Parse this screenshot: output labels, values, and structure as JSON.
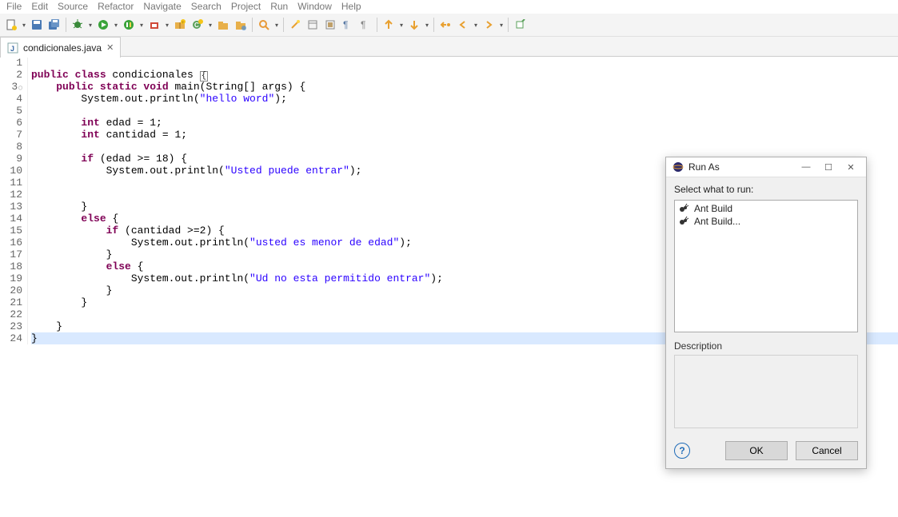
{
  "menu": [
    "File",
    "Edit",
    "Source",
    "Refactor",
    "Navigate",
    "Search",
    "Project",
    "Run",
    "Window",
    "Help"
  ],
  "tab": {
    "label": "condicionales.java"
  },
  "code": {
    "lines": [
      {
        "n": 1,
        "tokens": []
      },
      {
        "n": 2,
        "tokens": [
          {
            "c": "kw",
            "t": "public class"
          },
          {
            "c": "plain",
            "t": " condicionales "
          },
          {
            "c": "boxch",
            "t": "{"
          }
        ]
      },
      {
        "n": 3,
        "circ": true,
        "tokens": [
          {
            "c": "plain",
            "t": "    "
          },
          {
            "c": "kw",
            "t": "public static void"
          },
          {
            "c": "plain",
            "t": " main(String[] args) {"
          }
        ]
      },
      {
        "n": 4,
        "tokens": [
          {
            "c": "plain",
            "t": "        System.out.println("
          },
          {
            "c": "str",
            "t": "\"hello word\""
          },
          {
            "c": "plain",
            "t": ");"
          }
        ]
      },
      {
        "n": 5,
        "tokens": []
      },
      {
        "n": 6,
        "tokens": [
          {
            "c": "plain",
            "t": "        "
          },
          {
            "c": "kw",
            "t": "int"
          },
          {
            "c": "plain",
            "t": " edad = 1;"
          }
        ]
      },
      {
        "n": 7,
        "tokens": [
          {
            "c": "plain",
            "t": "        "
          },
          {
            "c": "kw",
            "t": "int"
          },
          {
            "c": "plain",
            "t": " cantidad = 1;"
          }
        ]
      },
      {
        "n": 8,
        "tokens": []
      },
      {
        "n": 9,
        "tokens": [
          {
            "c": "plain",
            "t": "        "
          },
          {
            "c": "kw",
            "t": "if"
          },
          {
            "c": "plain",
            "t": " (edad >= 18) {"
          }
        ]
      },
      {
        "n": 10,
        "tokens": [
          {
            "c": "plain",
            "t": "            System.out.println("
          },
          {
            "c": "str",
            "t": "\"Usted puede entrar\""
          },
          {
            "c": "plain",
            "t": ");"
          }
        ]
      },
      {
        "n": 11,
        "tokens": []
      },
      {
        "n": 12,
        "tokens": []
      },
      {
        "n": 13,
        "tokens": [
          {
            "c": "plain",
            "t": "        }"
          }
        ]
      },
      {
        "n": 14,
        "tokens": [
          {
            "c": "plain",
            "t": "        "
          },
          {
            "c": "kw",
            "t": "else"
          },
          {
            "c": "plain",
            "t": " {"
          }
        ]
      },
      {
        "n": 15,
        "tokens": [
          {
            "c": "plain",
            "t": "            "
          },
          {
            "c": "kw",
            "t": "if"
          },
          {
            "c": "plain",
            "t": " (cantidad >=2) {"
          }
        ]
      },
      {
        "n": 16,
        "tokens": [
          {
            "c": "plain",
            "t": "                System.out.println("
          },
          {
            "c": "str",
            "t": "\"usted es menor de edad\""
          },
          {
            "c": "plain",
            "t": ");"
          }
        ]
      },
      {
        "n": 17,
        "tokens": [
          {
            "c": "plain",
            "t": "            }"
          }
        ]
      },
      {
        "n": 18,
        "tokens": [
          {
            "c": "plain",
            "t": "            "
          },
          {
            "c": "kw",
            "t": "else"
          },
          {
            "c": "plain",
            "t": " {"
          }
        ]
      },
      {
        "n": 19,
        "tokens": [
          {
            "c": "plain",
            "t": "                System.out.println("
          },
          {
            "c": "str",
            "t": "\"Ud no esta permitido entrar\""
          },
          {
            "c": "plain",
            "t": ");"
          }
        ]
      },
      {
        "n": 20,
        "tokens": [
          {
            "c": "plain",
            "t": "            }"
          }
        ]
      },
      {
        "n": 21,
        "tokens": [
          {
            "c": "plain",
            "t": "        }"
          }
        ]
      },
      {
        "n": 22,
        "tokens": []
      },
      {
        "n": 23,
        "tokens": [
          {
            "c": "plain",
            "t": "    }"
          }
        ]
      },
      {
        "n": 24,
        "hl": true,
        "tokens": [
          {
            "c": "plain",
            "t": "}"
          }
        ]
      }
    ]
  },
  "dialog": {
    "title": "Run As",
    "label": "Select what to run:",
    "items": [
      "Ant Build",
      "Ant Build..."
    ],
    "desc_label": "Description",
    "ok": "OK",
    "cancel": "Cancel"
  }
}
